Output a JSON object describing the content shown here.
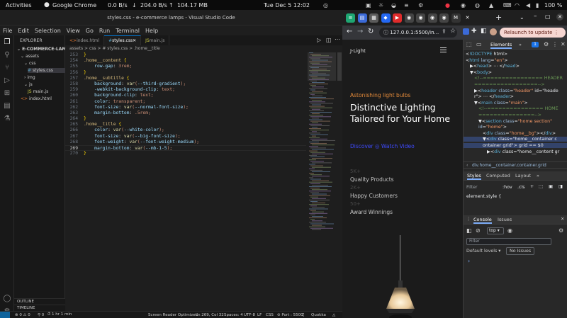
{
  "topbar": {
    "activities": "Activities",
    "app": "Google Chrome",
    "net_down": "0.0 B/s",
    "net_down_arrow": "↓",
    "net_up": "204.0 B/s",
    "net_up_arrow": "↑",
    "mem": "104.17 MB",
    "clock": "Tue Dec 5  12:02",
    "battery": "100 %"
  },
  "vscode": {
    "title": "styles.css - e-commerce lamps - Visual Studio Code",
    "menu": [
      "File",
      "Edit",
      "Selection",
      "View",
      "Go",
      "Run",
      "Terminal",
      "Help"
    ],
    "explorer": {
      "header": "EXPLORER",
      "project": "E-COMMERCE-LAMPS",
      "items": [
        {
          "label": "assets",
          "indent": 1,
          "icon": "folder-open-icon"
        },
        {
          "label": "css",
          "indent": 2,
          "icon": "folder-open-icon"
        },
        {
          "label": "styles.css",
          "indent": 3,
          "icon": "css-icon"
        },
        {
          "label": "img",
          "indent": 2,
          "icon": "folder-icon"
        },
        {
          "label": "js",
          "indent": 2,
          "icon": "folder-open-icon"
        },
        {
          "label": "main.js",
          "indent": 3,
          "icon": "js-icon"
        },
        {
          "label": "index.html",
          "indent": 1,
          "icon": "html-icon"
        }
      ],
      "outline": "OUTLINE",
      "timeline": "TIMELINE"
    },
    "tabs": [
      {
        "label": "index.html",
        "active": false
      },
      {
        "label": "styles.css",
        "active": true
      },
      {
        "label": "main.js",
        "active": false
      }
    ],
    "breadcrumb": "assets > css > # styles.css > .home__title",
    "code": [
      {
        "n": "253",
        "t": "}"
      },
      {
        "n": "254",
        "t": ".home__content {"
      },
      {
        "n": "255",
        "t": "    row-gap: 3rem;"
      },
      {
        "n": "256",
        "t": "}"
      },
      {
        "n": "257",
        "t": ".home__subtitle {"
      },
      {
        "n": "258",
        "t": "    background: var(--third-gradient);"
      },
      {
        "n": "259",
        "t": "    -webkit-background-clip: text;"
      },
      {
        "n": "260",
        "t": "    background-clip: text;"
      },
      {
        "n": "261",
        "t": "    color: transparent;"
      },
      {
        "n": "262",
        "t": "    font-size: var(--normal-font-size);"
      },
      {
        "n": "263",
        "t": "    margin-bottom: .5rem;"
      },
      {
        "n": "264",
        "t": "}"
      },
      {
        "n": "265",
        "t": ".home__title {"
      },
      {
        "n": "266",
        "t": "    color: var(--white-color);"
      },
      {
        "n": "267",
        "t": "    font-size: var(--big-font-size);"
      },
      {
        "n": "268",
        "t": "    font-weight: var(--font-weight-medium);"
      },
      {
        "n": "269",
        "t": "    margin-bottom: var(--mb-1-5);"
      },
      {
        "n": "270",
        "t": "}"
      }
    ],
    "current_line": "269",
    "status": {
      "errors": "⊗ 0 ⚠ 0",
      "ports": "⚲ 0",
      "time": "⏱ 1 hr 1 min",
      "reader": "Screen Reader Optimized",
      "position": "Ln 269, Col 32",
      "spaces": "Spaces: 4",
      "encoding": "UTF-8",
      "eol": "LF",
      "lang": "CSS",
      "port": "⊘ Port : 5500",
      "quokka": "Quokka"
    }
  },
  "chrome": {
    "tab_icons": [
      {
        "g": "≡",
        "c": "#1ea672"
      },
      {
        "g": "▤",
        "c": "#3b6ad8"
      },
      {
        "g": "▦",
        "c": "#5b5b5b"
      },
      {
        "g": "◆",
        "c": "#2468f2"
      },
      {
        "g": "▶",
        "c": "#e02b2b"
      },
      {
        "g": "◉",
        "c": "#444"
      },
      {
        "g": "◉",
        "c": "#444"
      },
      {
        "g": "◉",
        "c": "#444"
      },
      {
        "g": "◉",
        "c": "#444"
      },
      {
        "g": "M",
        "c": "#333"
      }
    ],
    "url": "127.0.0.1:5500/in...",
    "relaunch": "Relaunch to update",
    "new_tab": "+"
  },
  "page": {
    "brand": "J-Light",
    "subtitle": "Astonishing light bulbs",
    "title": "Distinctive Lighting Tailored for Your Home",
    "discover": "Discover",
    "watch": "◎ Watch Video",
    "stats": [
      {
        "num": "5K+",
        "label": "Quality Products"
      },
      {
        "num": "2K+",
        "label": "Happy Customers"
      },
      {
        "num": "50+",
        "label": "Award Winnings"
      }
    ]
  },
  "devtools": {
    "tabs": [
      "Elements",
      "»"
    ],
    "badge": "1",
    "html": [
      {
        "d": 0,
        "h": "<!DOCTYPE html>"
      },
      {
        "d": 0,
        "h": "<html lang=\"en\">"
      },
      {
        "d": 1,
        "h": "▶<head> ⋯ </head>"
      },
      {
        "d": 1,
        "h": "▼<body>"
      },
      {
        "d": 2,
        "h": "<!--================ HEADER"
      },
      {
        "d": 2,
        "h": "=================-->"
      },
      {
        "d": 2,
        "h": "▶<header class=\"header\" id=\"heade"
      },
      {
        "d": 2,
        "h": "r\"> ⋯ </header>"
      },
      {
        "d": 2,
        "h": "▼<main class=\"main\">"
      },
      {
        "d": 3,
        "h": "<!--=============== HOME"
      },
      {
        "d": 3,
        "h": "===============-->"
      },
      {
        "d": 3,
        "h": "▼<section class=\"home section\""
      },
      {
        "d": 3,
        "h": " id=\"home\">"
      },
      {
        "d": 4,
        "h": "<div class=\"home__bg\"></div>"
      },
      {
        "d": 4,
        "h": "▼<div class=\"home__container c"
      },
      {
        "d": 4,
        "h": "ontainer grid\"> grid == $0"
      },
      {
        "d": 5,
        "h": "▶<div class=\"home__content gr"
      }
    ],
    "crumb": "div.home__container.container.grid",
    "styles_tabs": [
      "Styles",
      "Computed",
      "Layout",
      "»"
    ],
    "filter": "Filter",
    "hov": ":hov",
    "cls": ".cls",
    "element_style": "element.style {",
    "drawer_tabs": [
      "Console",
      "Issues"
    ],
    "top": "top",
    "console_filter": "Filter",
    "levels": "Default levels ▾",
    "issues": "No Issues",
    "prompt": "›"
  }
}
